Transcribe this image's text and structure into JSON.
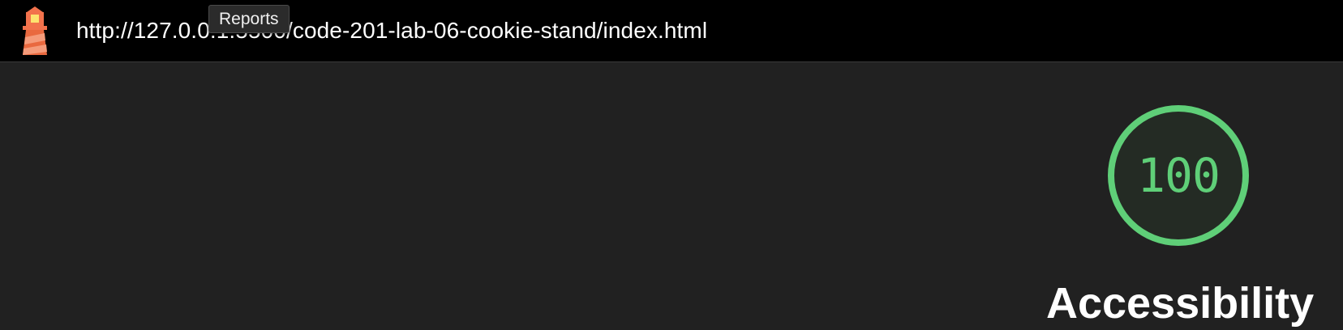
{
  "topbar": {
    "url": "http://127.0.0.1:5500/code-201-lab-06-cookie-stand/index.html",
    "tooltip": "Reports",
    "logo_icon": "lighthouse-icon"
  },
  "category": {
    "score": "100",
    "title": "Accessibility",
    "score_fraction": 1.0,
    "color": "#5fcf78"
  },
  "colors": {
    "topbar_bg": "#000000",
    "page_bg": "#212121",
    "pass": "#5fcf78"
  }
}
